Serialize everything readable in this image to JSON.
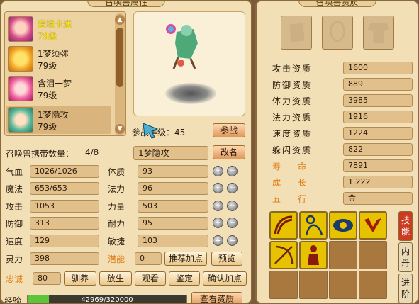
{
  "left": {
    "title": "召唤兽属性",
    "pets": [
      {
        "name": "逆境卡速",
        "level": "79级",
        "active": true,
        "selected": false
      },
      {
        "name": "1梦须弥",
        "level": "79级",
        "active": false,
        "selected": false
      },
      {
        "name": "含泪一梦",
        "level": "79级",
        "active": false,
        "selected": false
      },
      {
        "name": "1梦隐攻",
        "level": "79级",
        "active": false,
        "selected": true
      }
    ],
    "battle_level": "参战等级：45",
    "battle_button": "参战",
    "carry_count_label": "召唤兽携带数量：",
    "carry_count": "4/8",
    "pet_name_value": "1梦隐攻",
    "rename_button": "改名",
    "stats": [
      {
        "label": "气血",
        "value": "1026/1026"
      },
      {
        "label": "魔法",
        "value": "653/653"
      },
      {
        "label": "攻击",
        "value": "1053"
      },
      {
        "label": "防御",
        "value": "313"
      },
      {
        "label": "速度",
        "value": "129"
      },
      {
        "label": "灵力",
        "value": "398"
      }
    ],
    "attrs": [
      {
        "label": "体质",
        "value": "93"
      },
      {
        "label": "法力",
        "value": "96"
      },
      {
        "label": "力量",
        "value": "503"
      },
      {
        "label": "耐力",
        "value": "95"
      },
      {
        "label": "敏捷",
        "value": "103"
      }
    ],
    "potential_label": "潜能",
    "potential_value": "0",
    "recommend_button": "推荐加点",
    "preview_button": "预览",
    "loyalty_label": "忠诚",
    "loyalty_value": "80",
    "tame_button": "驯养",
    "release_button": "放生",
    "view_button": "观看",
    "appraise_button": "鉴定",
    "confirm_button": "确认加点",
    "exp_label": "经验",
    "exp_text": "42969/320000",
    "exp_fraction": 0.134,
    "view_aptitude_button": "查看资质"
  },
  "right": {
    "title": "召唤兽资质",
    "aptitudes": [
      {
        "label": "攻击资质",
        "value": "1600",
        "highlight": false
      },
      {
        "label": "防御资质",
        "value": "889",
        "highlight": false
      },
      {
        "label": "体力资质",
        "value": "3985",
        "highlight": false
      },
      {
        "label": "法力资质",
        "value": "1916",
        "highlight": false
      },
      {
        "label": "速度资质",
        "value": "1224",
        "highlight": false
      },
      {
        "label": "躲闪资质",
        "value": "822",
        "highlight": false
      },
      {
        "label": "寿　　命",
        "value": "7891",
        "highlight": true
      },
      {
        "label": "成　　长",
        "value": "1.222",
        "highlight": true
      },
      {
        "label": "五　　行",
        "value": "金",
        "highlight": true
      }
    ],
    "tabs": [
      "技能",
      "内丹",
      "进阶"
    ],
    "skills": [
      {
        "icon": "whip-skill-icon"
      },
      {
        "icon": "figure-skill-icon"
      },
      {
        "icon": "eye-skill-icon"
      },
      {
        "icon": "claw-skill-icon"
      },
      {
        "icon": "bow-skill-icon"
      },
      {
        "icon": "robed-figure-skill-icon"
      }
    ],
    "equip_icons": [
      "bracer-slot-icon",
      "necklace-slot-icon",
      "armor-slot-icon"
    ]
  },
  "colors": {
    "panel_bg": "#f2dfb6",
    "accent_red": "#c93c22",
    "skill_gold": "#e6c200",
    "orange_text": "#e07a10"
  }
}
